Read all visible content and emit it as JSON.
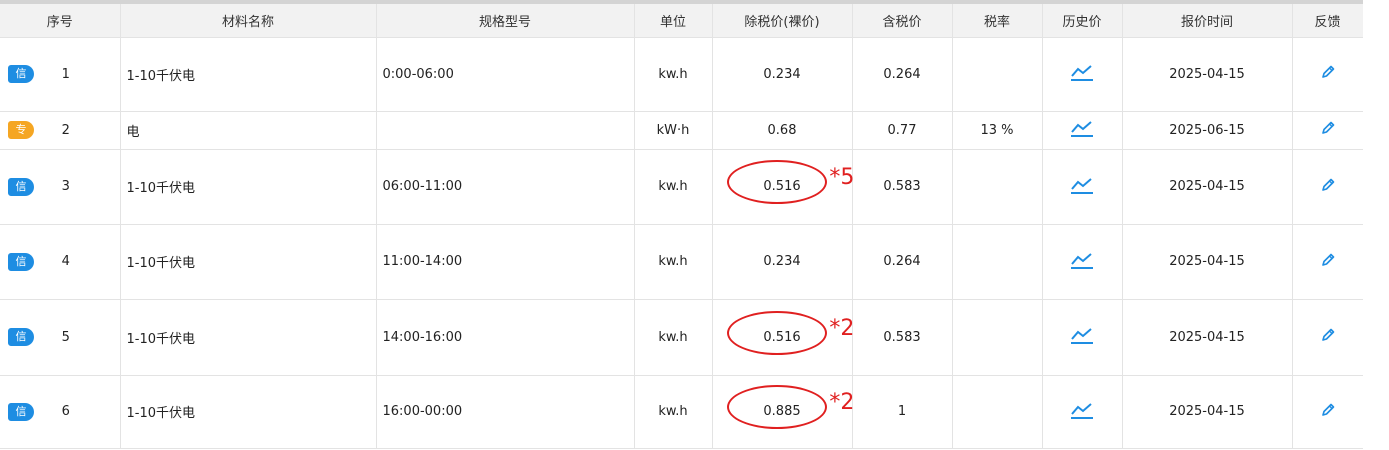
{
  "columns": [
    "序号",
    "材料名称",
    "规格型号",
    "单位",
    "除税价(裸价)",
    "含税价",
    "税率",
    "历史价",
    "报价时间",
    "反馈"
  ],
  "rows": [
    {
      "badge": "信",
      "badge_type": "xin",
      "seq": "1",
      "name": "1-10千伏电",
      "spec": "0:00-06:00",
      "unit": "kw.h",
      "pretax": "0.234",
      "taxed": "0.264",
      "rate": "",
      "time": "2025-04-15",
      "annotation": ""
    },
    {
      "badge": "专",
      "badge_type": "zhuan",
      "seq": "2",
      "name": "电",
      "spec": "",
      "unit": "kW·h",
      "pretax": "0.68",
      "taxed": "0.77",
      "rate": "13 %",
      "time": "2025-06-15",
      "annotation": ""
    },
    {
      "badge": "信",
      "badge_type": "xin",
      "seq": "3",
      "name": "1-10千伏电",
      "spec": "06:00-11:00",
      "unit": "kw.h",
      "pretax": "0.516",
      "taxed": "0.583",
      "rate": "",
      "time": "2025-04-15",
      "annotation": "*5"
    },
    {
      "badge": "信",
      "badge_type": "xin",
      "seq": "4",
      "name": "1-10千伏电",
      "spec": "11:00-14:00",
      "unit": "kw.h",
      "pretax": "0.234",
      "taxed": "0.264",
      "rate": "",
      "time": "2025-04-15",
      "annotation": ""
    },
    {
      "badge": "信",
      "badge_type": "xin",
      "seq": "5",
      "name": "1-10千伏电",
      "spec": "14:00-16:00",
      "unit": "kw.h",
      "pretax": "0.516",
      "taxed": "0.583",
      "rate": "",
      "time": "2025-04-15",
      "annotation": "*2"
    },
    {
      "badge": "信",
      "badge_type": "xin",
      "seq": "6",
      "name": "1-10千伏电",
      "spec": "16:00-00:00",
      "unit": "kw.h",
      "pretax": "0.885",
      "taxed": "1",
      "rate": "",
      "time": "2025-04-15",
      "annotation": "*2"
    }
  ],
  "icons": {
    "history": "line-chart-icon",
    "feedback": "pencil-edit-icon"
  },
  "colors": {
    "badge_xin": "#1e8de2",
    "badge_zhuan": "#f5a623",
    "icon_blue": "#1e8de2",
    "annotation_red": "#e02020",
    "header_bg": "#f2f2f2"
  }
}
